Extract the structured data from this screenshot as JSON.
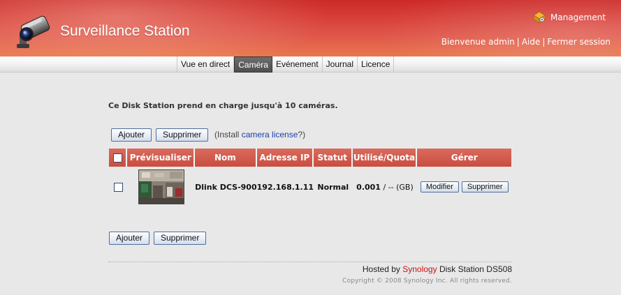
{
  "header": {
    "title": "Surveillance Station",
    "management_label": "Management",
    "user_links": [
      "Bienvenue admin",
      "Aide",
      "Fermer session"
    ],
    "separator": "|"
  },
  "nav": {
    "tabs": [
      {
        "label": "Vue en direct",
        "active": false
      },
      {
        "label": "Caméra",
        "active": true
      },
      {
        "label": "Evénement",
        "active": false
      },
      {
        "label": "Journal",
        "active": false
      },
      {
        "label": "Licence",
        "active": false
      }
    ]
  },
  "main": {
    "support_text": "Ce Disk Station prend en charge jusqu'à 10 caméras.",
    "add_label": "Ajouter",
    "delete_label": "Supprimer",
    "license_note_prefix": "(Install ",
    "license_link": "camera license",
    "license_note_suffix": "?)"
  },
  "table": {
    "headers": [
      "Prévisualiser",
      "Nom",
      "Adresse IP",
      "Statut",
      "Utilisé/Quota",
      "Gérer"
    ],
    "rows": [
      {
        "name": "Dlink DCS-900",
        "ip": "192.168.1.11",
        "status": "Normal",
        "usage_value": "0.001",
        "usage_rest": " / -- (GB)",
        "modify_label": "Modifier",
        "delete_label": "Supprimer"
      }
    ]
  },
  "footer": {
    "hosted_prefix": "Hosted by ",
    "brand": "Synology",
    "hosted_suffix": " Disk Station DS508",
    "copyright": "Copyright © 2008 Synology Inc. All rights reserved."
  },
  "colors": {
    "header_red": "#cc2a28",
    "header_orange": "#e9774e",
    "table_header": "#d0574a",
    "active_tab": "#5a5a5a",
    "brand_red": "#cc1111",
    "link_blue": "#1a3fae"
  },
  "icons": {
    "app": "camera-icon",
    "management": "management-icon"
  }
}
